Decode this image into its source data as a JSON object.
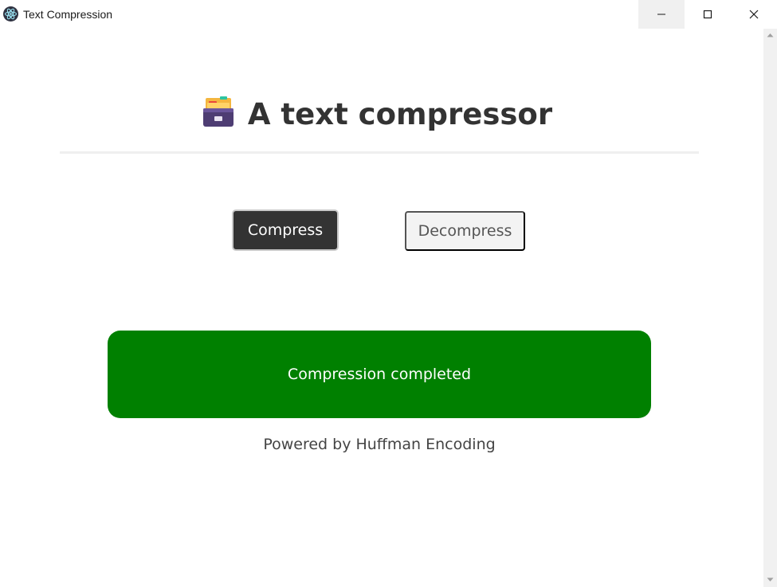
{
  "window": {
    "title": "Text Compression",
    "icon": "electron-atom-icon",
    "controls": [
      "minimize-icon",
      "maximize-icon",
      "close-icon"
    ]
  },
  "header": {
    "icon": "card-file-box-icon",
    "title": "A text compressor"
  },
  "actions": {
    "compress_label": "Compress",
    "decompress_label": "Decompress",
    "selected": "Compress"
  },
  "status": {
    "message": "Compression completed",
    "color": "#008000"
  },
  "footer": {
    "text": "Powered by Huffman Encoding"
  },
  "colors": {
    "primary_button": "#333333",
    "secondary_button": "#f3f3f3",
    "success": "#008000",
    "text": "#333333"
  }
}
